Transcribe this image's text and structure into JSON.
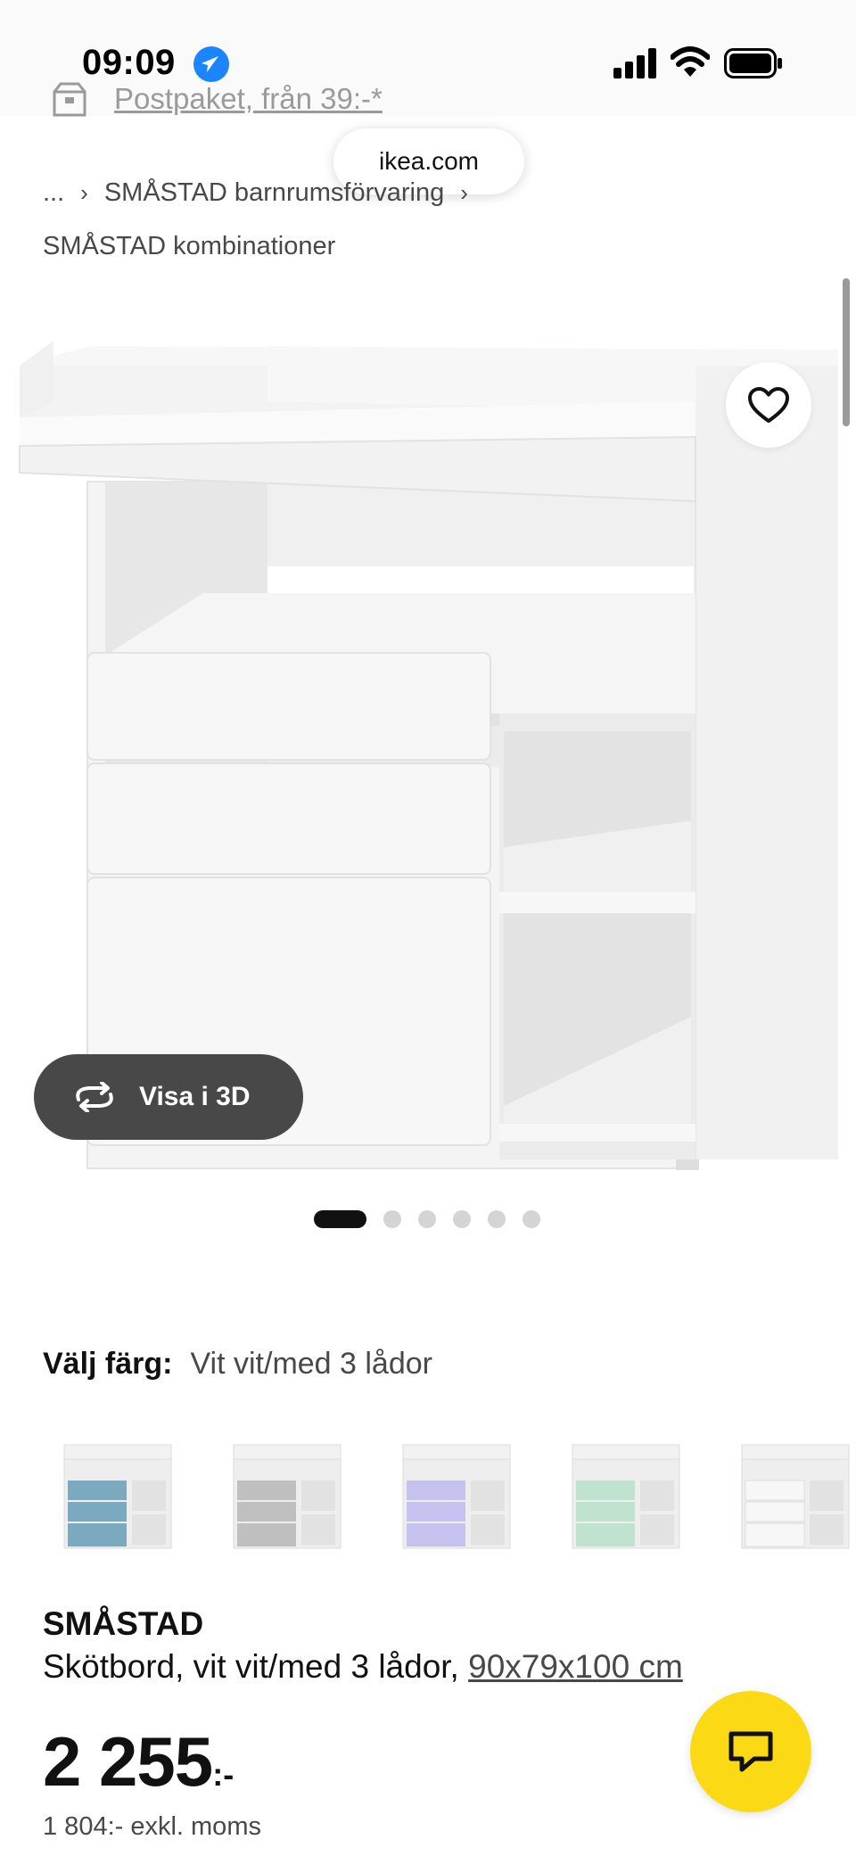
{
  "status_bar": {
    "time": "09:09"
  },
  "shipping_banner": {
    "text": "Postpaket, från 39:-*"
  },
  "browser": {
    "url": "ikea.com"
  },
  "breadcrumb": {
    "ellipsis": "...",
    "parent": "SMÅSTAD barnrumsförvaring",
    "current": "SMÅSTAD kombinationer"
  },
  "gallery": {
    "view3d_label": "Visa i 3D",
    "image_count": 6,
    "active_index": 0
  },
  "color_picker": {
    "label": "Välj färg:",
    "selected": "Vit vit/med 3 lådor",
    "swatch_drawer_colors": [
      "#7ba9c0",
      "#bfbfbf",
      "#c6c2f0",
      "#bfe3cf",
      "#f2f2f2"
    ]
  },
  "product": {
    "name": "SMÅSTAD",
    "description": "Skötbord, vit vit/med 3 lådor,",
    "dimensions": "90x79x100 cm",
    "price": "2 255",
    "price_suffix": ":-",
    "price_excl_vat": "1 804:- exkl. moms"
  },
  "colors": {
    "ikea_yellow": "#fbd914",
    "pill_dark": "#484848"
  }
}
